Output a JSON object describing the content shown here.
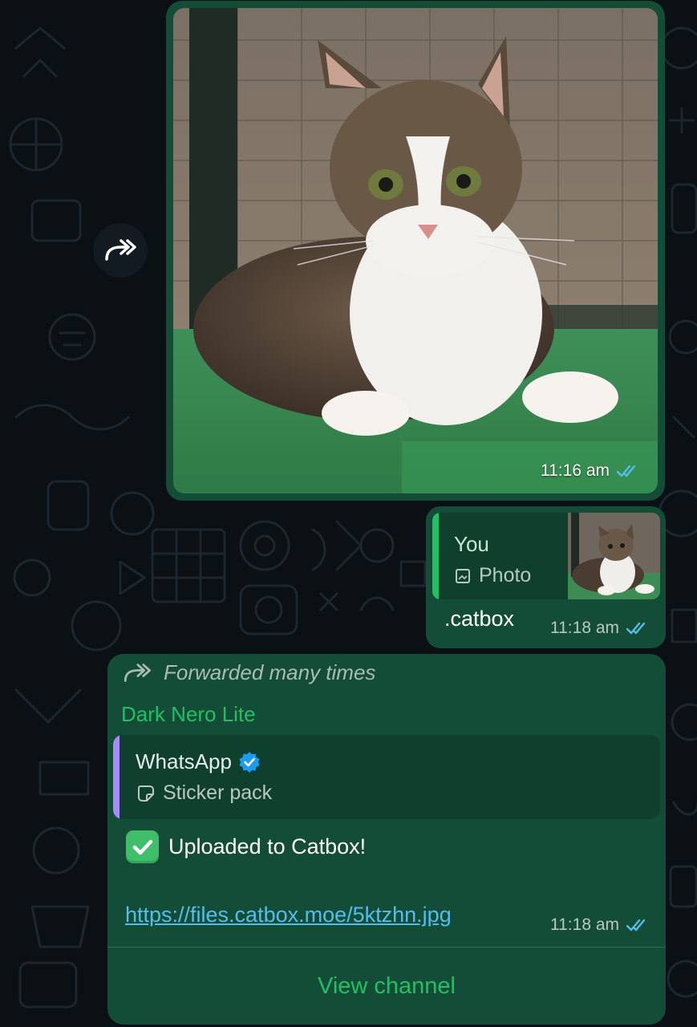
{
  "colors": {
    "accent": "#21c063",
    "bubble": "#144d37",
    "read_ticks": "#53bdeb",
    "link": "#53bdeb",
    "background": "#0b1014"
  },
  "messages": {
    "photo": {
      "time": "11:16 am",
      "status": "read",
      "status_icon": "double-check-icon"
    },
    "reply": {
      "quoted_sender": "You",
      "quoted_type": "Photo",
      "quoted_icon": "image-icon",
      "text": ".catbox",
      "time": "11:18 am",
      "status": "read"
    },
    "channel": {
      "forwarded_label": "Forwarded many times",
      "sender": "Dark Nero Lite",
      "card_title": "WhatsApp",
      "card_verified_icon": "verified-badge-icon",
      "card_subtitle": "Sticker pack",
      "card_sub_icon": "sticker-icon",
      "status_emoji": "white-check-mark-icon",
      "status_text": "Uploaded to Catbox!",
      "link": "https://files.catbox.moe/5ktzhn.jpg",
      "time": "11:18 am",
      "status": "read",
      "action_label": "View channel"
    }
  }
}
